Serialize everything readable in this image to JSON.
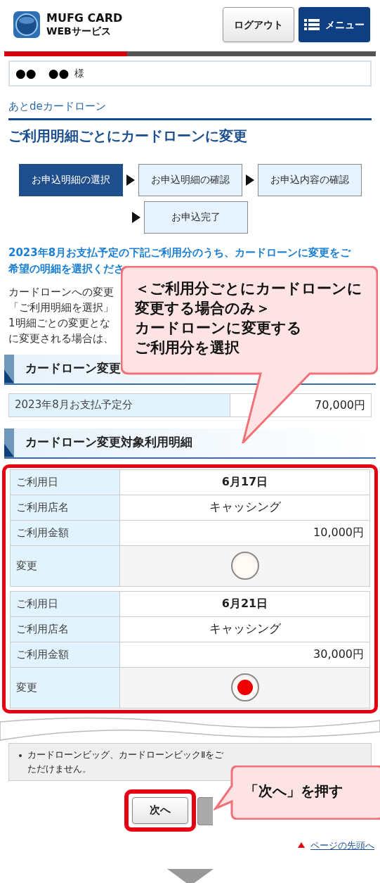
{
  "header": {
    "logo_line1": "MUFG CARD",
    "logo_line2": "WEBサービス",
    "logout": "ログアウト",
    "menu": "メニュー"
  },
  "user": {
    "name": "●●　●●",
    "honorific": "様"
  },
  "breadcrumb": "あとdeカードローン",
  "title": "ご利用明細ごとにカードローンに変更",
  "steps": [
    {
      "label": "お申込明細の選択",
      "selected": true
    },
    {
      "label": "お申込明細の確認",
      "selected": false
    },
    {
      "label": "お申込内容の確認",
      "selected": false
    },
    {
      "label": "お申込完了",
      "selected": false
    }
  ],
  "lead_lines": [
    "2023年8月お支払予定の下記ご利用分のうち、カードローンに変更をご",
    "希望の明細を選択くださ"
  ],
  "body_lines": [
    "カードローンへの変更",
    "「ご利用明細を選択」",
    "1明細ごとの変更とな",
    "に変更される場合は、"
  ],
  "summary": {
    "heading": "カードローン変更",
    "label": "2023年8月お支払予定分",
    "value": "70,000円"
  },
  "details": {
    "heading": "カードローン変更対象利用明細",
    "items": [
      {
        "rows": [
          {
            "label": "ご利用日",
            "value": "6月17日",
            "kind": "date"
          },
          {
            "label": "ご利用店名",
            "value": "キャッシング",
            "kind": "text"
          },
          {
            "label": "ご利用金額",
            "value": "10,000円",
            "kind": "amount"
          }
        ],
        "change_label": "変更",
        "selected": false
      },
      {
        "rows": [
          {
            "label": "ご利用日",
            "value": "6月21日",
            "kind": "date"
          },
          {
            "label": "ご利用店名",
            "value": "キャッシング",
            "kind": "text"
          },
          {
            "label": "ご利用金額",
            "value": "30,000円",
            "kind": "amount"
          }
        ],
        "change_label": "変更",
        "selected": true
      }
    ]
  },
  "note": {
    "line1": "カードローンビッグ、カードローンビックⅡをご",
    "line2": "ただけません。"
  },
  "next_button": "次へ",
  "page_top": "ページの先頭へ",
  "callouts": [
    {
      "lines": [
        "＜ご利用分ごとにカードローンに",
        "変更する場合のみ＞",
        "カードローンに変更する",
        "ご利用分を選択"
      ]
    },
    {
      "lines": [
        "「次へ」を押す"
      ]
    }
  ]
}
